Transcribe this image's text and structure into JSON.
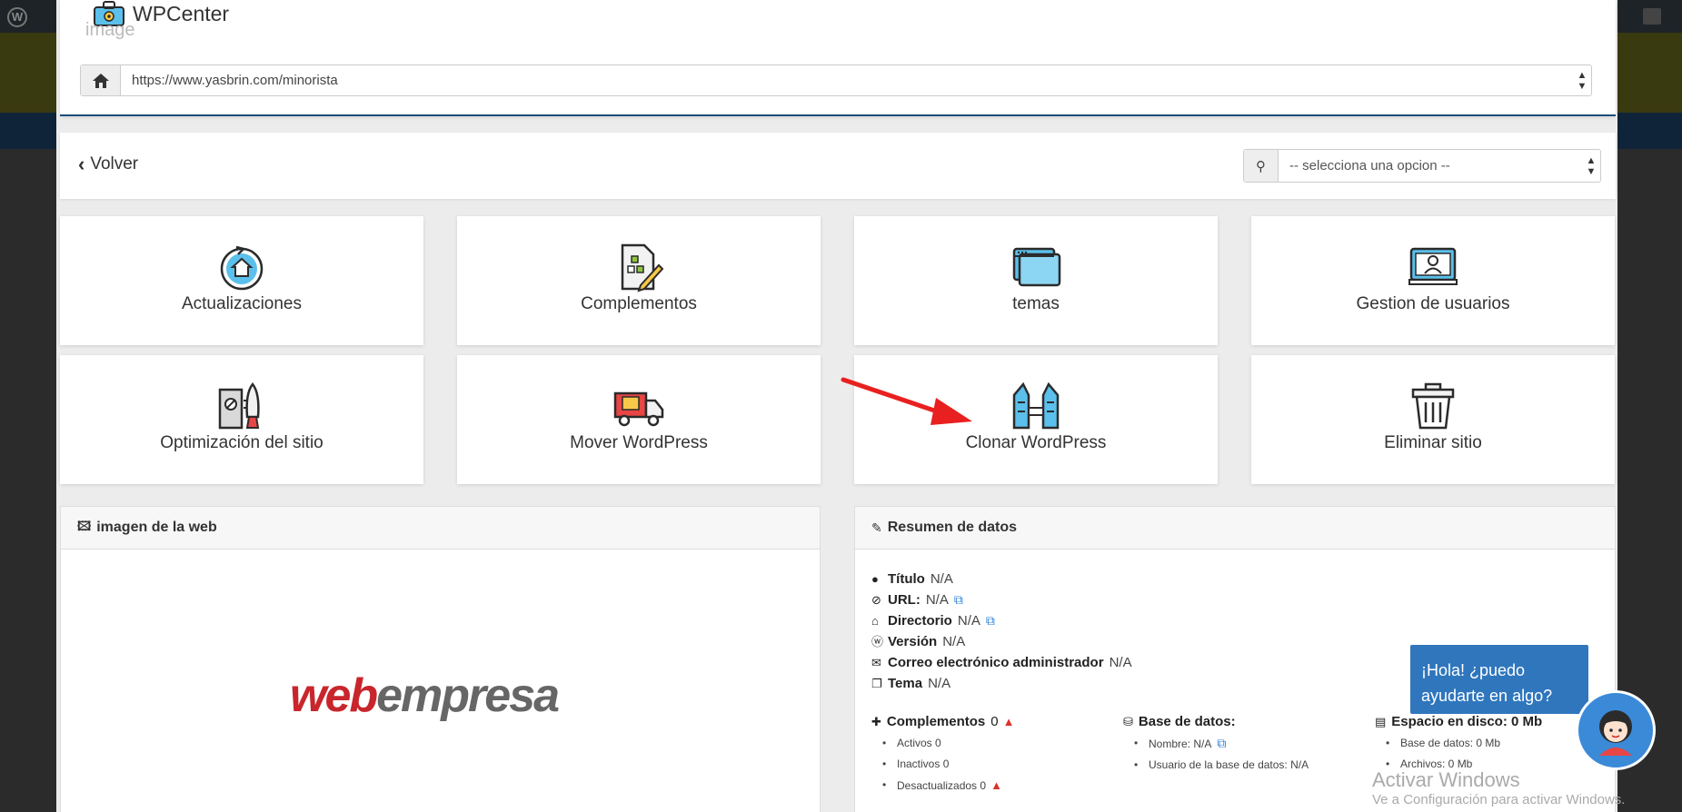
{
  "backdrop": {
    "wp_logo_glyph": "W"
  },
  "header": {
    "title": "WPCenter",
    "ghost_text": "image",
    "url": "https://www.yasbrin.com/minorista"
  },
  "toolbar": {
    "back_label": "Volver",
    "select_placeholder": "-- selecciona una opcion --"
  },
  "tiles": [
    {
      "label": "Actualizaciones",
      "icon": "update-home-icon"
    },
    {
      "label": "Complementos",
      "icon": "plugin-document-icon"
    },
    {
      "label": "temas",
      "icon": "browser-windows-icon"
    },
    {
      "label": "Gestion de usuarios",
      "icon": "user-monitor-icon"
    },
    {
      "label": "Optimización del sitio",
      "icon": "server-rocket-icon"
    },
    {
      "label": "Mover WordPress",
      "icon": "moving-truck-icon"
    },
    {
      "label": "Clonar WordPress",
      "icon": "twin-towers-icon"
    },
    {
      "label": "Eliminar sitio",
      "icon": "trash-icon"
    }
  ],
  "image_panel": {
    "title": "imagen de la web",
    "logo_part1": "web",
    "logo_part2": "empresa"
  },
  "summary_panel": {
    "title": "Resumen de datos",
    "rows": [
      {
        "key": "Título",
        "value": "N/A"
      },
      {
        "key": "URL:",
        "value": "N/A"
      },
      {
        "key": "Directorio",
        "value": "N/A"
      },
      {
        "key": "Versión",
        "value": "N/A"
      },
      {
        "key": "Correo electrónico administrador",
        "value": "N/A"
      },
      {
        "key": "Tema",
        "value": "N/A"
      }
    ],
    "plugins": {
      "title": "Complementos",
      "count": "0",
      "items": [
        "Activos 0",
        "Inactivos 0",
        "Desactualizados 0"
      ]
    },
    "database": {
      "title": "Base de datos:",
      "items": [
        "Nombre: N/A",
        "Usuario de la base de datos: N/A"
      ]
    },
    "disk": {
      "title": "Espacio en disco: 0 Mb",
      "items": [
        "Base de datos: 0 Mb",
        "Archivos: 0 Mb"
      ]
    }
  },
  "watermark": {
    "title": "Activar Windows",
    "subtitle": "Ve a Configuración para activar Windows."
  },
  "chat": {
    "line1": "¡Hola! ¿puedo",
    "line2": "ayudarte en algo?"
  },
  "colors": {
    "accent": "#1b4d7a",
    "chat": "#2f76bd",
    "brand_red": "#c8262c",
    "arrow": "#e8201f",
    "link": "#2a7ed8"
  }
}
